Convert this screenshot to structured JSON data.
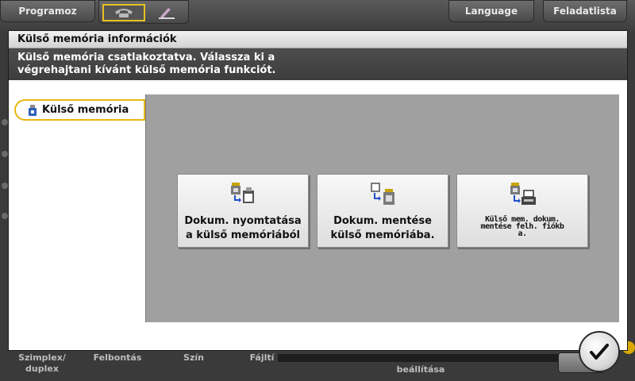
{
  "topbar": {
    "programoz": "Programoz",
    "language": "Language",
    "task_list": "Feladatlista"
  },
  "bottombar": {
    "simplex_duplex": "Szimplex/ duplex",
    "resolution": "Felbontás",
    "color": "Szín",
    "file_type": "Fájltí",
    "settings": "beállítása"
  },
  "dialog": {
    "title": "Külső memória információk",
    "message_line1": "Külső memória csatlakoztatva. Válassza ki a",
    "message_line2": "végrehajtani kívánt külső memória funkciót.",
    "tab_label": "Külső memória",
    "buttons": [
      {
        "line1": "Dokum. nyomtatása",
        "line2": "a külső memóriából",
        "icon": "print-from-usb-icon"
      },
      {
        "line1": "Dokum. mentése",
        "line2": "külső memóriába.",
        "icon": "save-to-usb-icon"
      },
      {
        "line1": "Külső mem. dokum.",
        "line2": "mentése felh. fiókb",
        "line3": "a.",
        "icon": "usb-to-user-box-icon"
      }
    ],
    "ok_icon": "checkmark-icon"
  },
  "colors": {
    "accent": "#e8b810",
    "panel": "#a0a0a0",
    "message_bg": "#444444"
  }
}
